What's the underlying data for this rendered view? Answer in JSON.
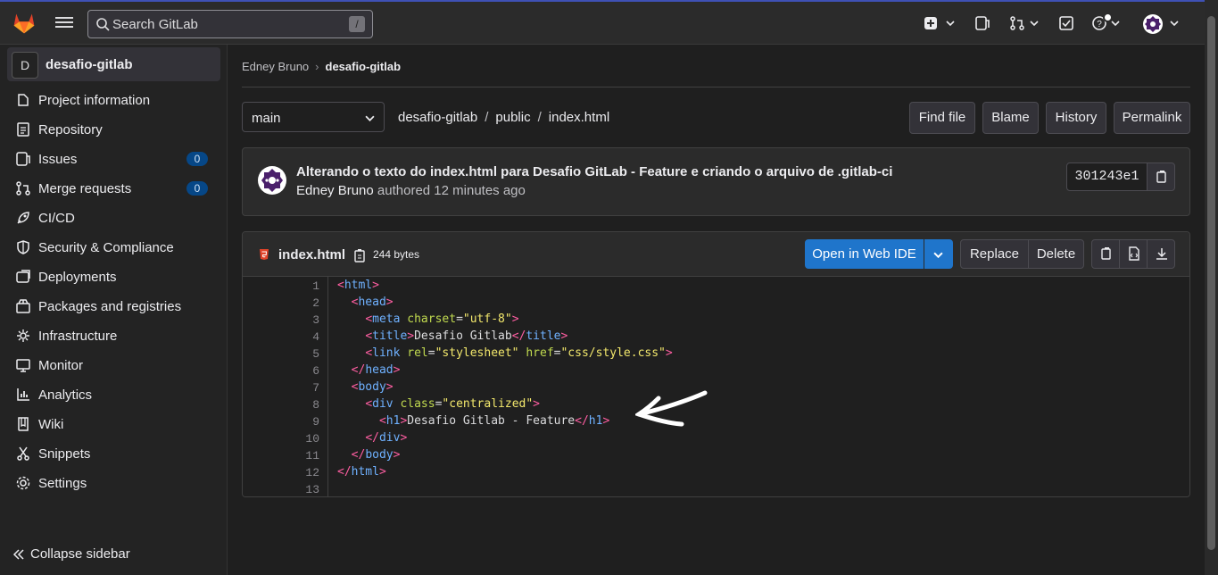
{
  "topbar": {
    "search_placeholder": "Search GitLab",
    "search_shortcut": "/"
  },
  "sidebar": {
    "project_initial": "D",
    "project_name": "desafio-gitlab",
    "items": [
      {
        "label": "Project information",
        "icon": "project-icon"
      },
      {
        "label": "Repository",
        "icon": "doc-icon"
      },
      {
        "label": "Issues",
        "icon": "issues-icon",
        "badge": "0"
      },
      {
        "label": "Merge requests",
        "icon": "merge-request-icon",
        "badge": "0"
      },
      {
        "label": "CI/CD",
        "icon": "rocket-icon"
      },
      {
        "label": "Security & Compliance",
        "icon": "shield-icon"
      },
      {
        "label": "Deployments",
        "icon": "deployments-icon"
      },
      {
        "label": "Packages and registries",
        "icon": "package-icon"
      },
      {
        "label": "Infrastructure",
        "icon": "cloud-gear-icon"
      },
      {
        "label": "Monitor",
        "icon": "monitor-icon"
      },
      {
        "label": "Analytics",
        "icon": "chart-icon"
      },
      {
        "label": "Wiki",
        "icon": "book-icon"
      },
      {
        "label": "Snippets",
        "icon": "snippet-icon"
      },
      {
        "label": "Settings",
        "icon": "gear-icon"
      }
    ],
    "collapse_label": "Collapse sidebar"
  },
  "breadcrumb": {
    "owner": "Edney Bruno",
    "project": "desafio-gitlab"
  },
  "branch": {
    "selected": "main"
  },
  "path": {
    "root": "desafio-gitlab",
    "dir": "public",
    "file": "index.html"
  },
  "actions": {
    "find_file": "Find file",
    "blame": "Blame",
    "history": "History",
    "permalink": "Permalink"
  },
  "commit": {
    "title": "Alterando o texto do index.html para Desafio GitLab - Feature e criando o arquivo de .gitlab-ci",
    "author": "Edney Bruno",
    "authored_text": "authored",
    "time": "12 minutes ago",
    "sha": "301243e1"
  },
  "file": {
    "name": "index.html",
    "size": "244 bytes",
    "open_web_ide": "Open in Web IDE",
    "replace": "Replace",
    "delete": "Delete"
  },
  "code_lines": [
    "1",
    "2",
    "3",
    "4",
    "5",
    "6",
    "7",
    "8",
    "9",
    "10",
    "11",
    "12",
    "13"
  ],
  "colors": {
    "accent": "#1f75cb",
    "badge": "#064787",
    "tag": "#ff5ea2",
    "attr": "#c0d94f",
    "string": "#f3e86c"
  }
}
